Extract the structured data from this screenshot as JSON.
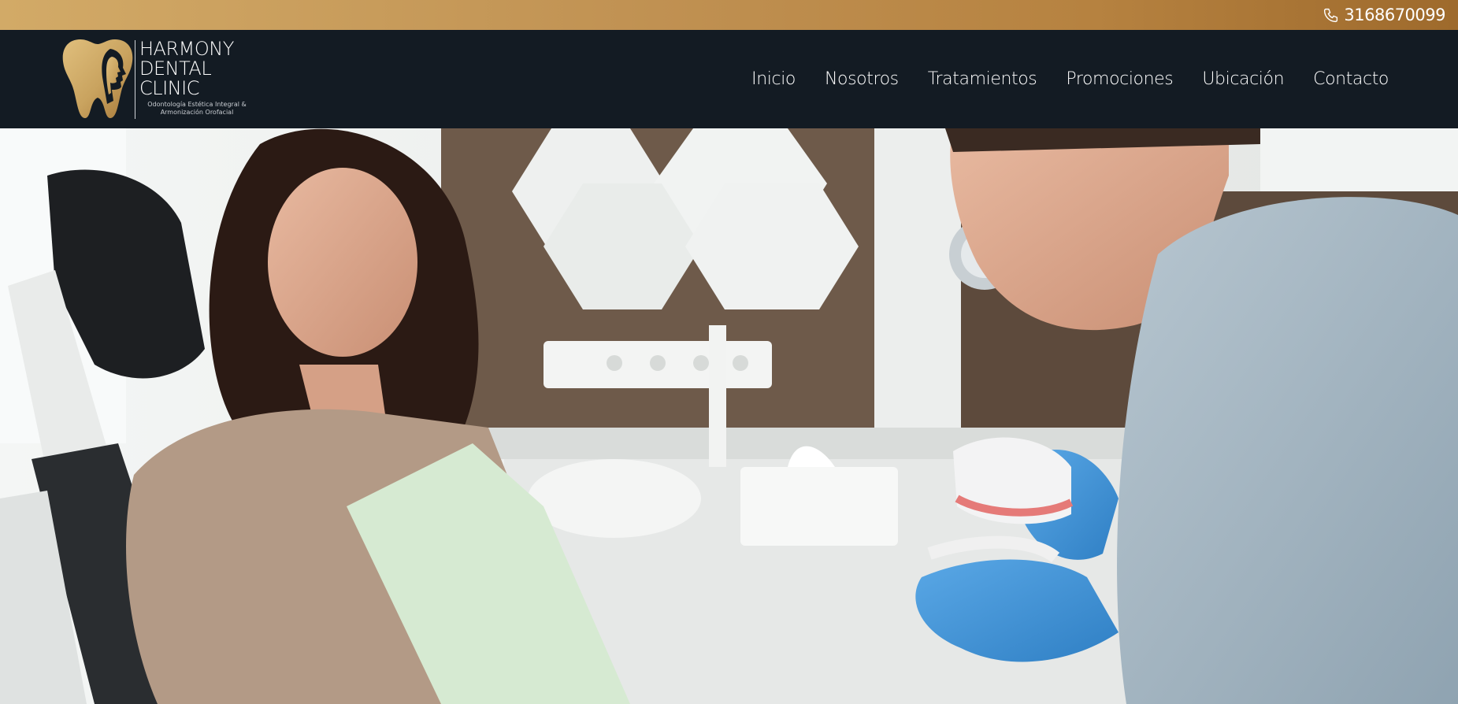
{
  "topbar": {
    "phone_icon": "phone-icon",
    "phone": "3168670099",
    "gradient_colors": [
      "#d2aa67",
      "#9e6a2c"
    ]
  },
  "brand": {
    "name_lines": [
      "HARMONY",
      "DENTAL",
      "CLINIC"
    ],
    "tagline_lines": [
      "Odontología Estética Integral &",
      "Armonización Orofacial"
    ],
    "logo_icon": "tooth-woman-profile-logo",
    "gold": "#c9a35f"
  },
  "nav": {
    "background": "#131b23",
    "items": [
      {
        "label": "Inicio"
      },
      {
        "label": "Nosotros"
      },
      {
        "label": "Tratamientos"
      },
      {
        "label": "Promociones"
      },
      {
        "label": "Ubicación"
      },
      {
        "label": "Contacto"
      }
    ]
  },
  "hero": {
    "image_subject": "dentist showing dental model to patient"
  }
}
